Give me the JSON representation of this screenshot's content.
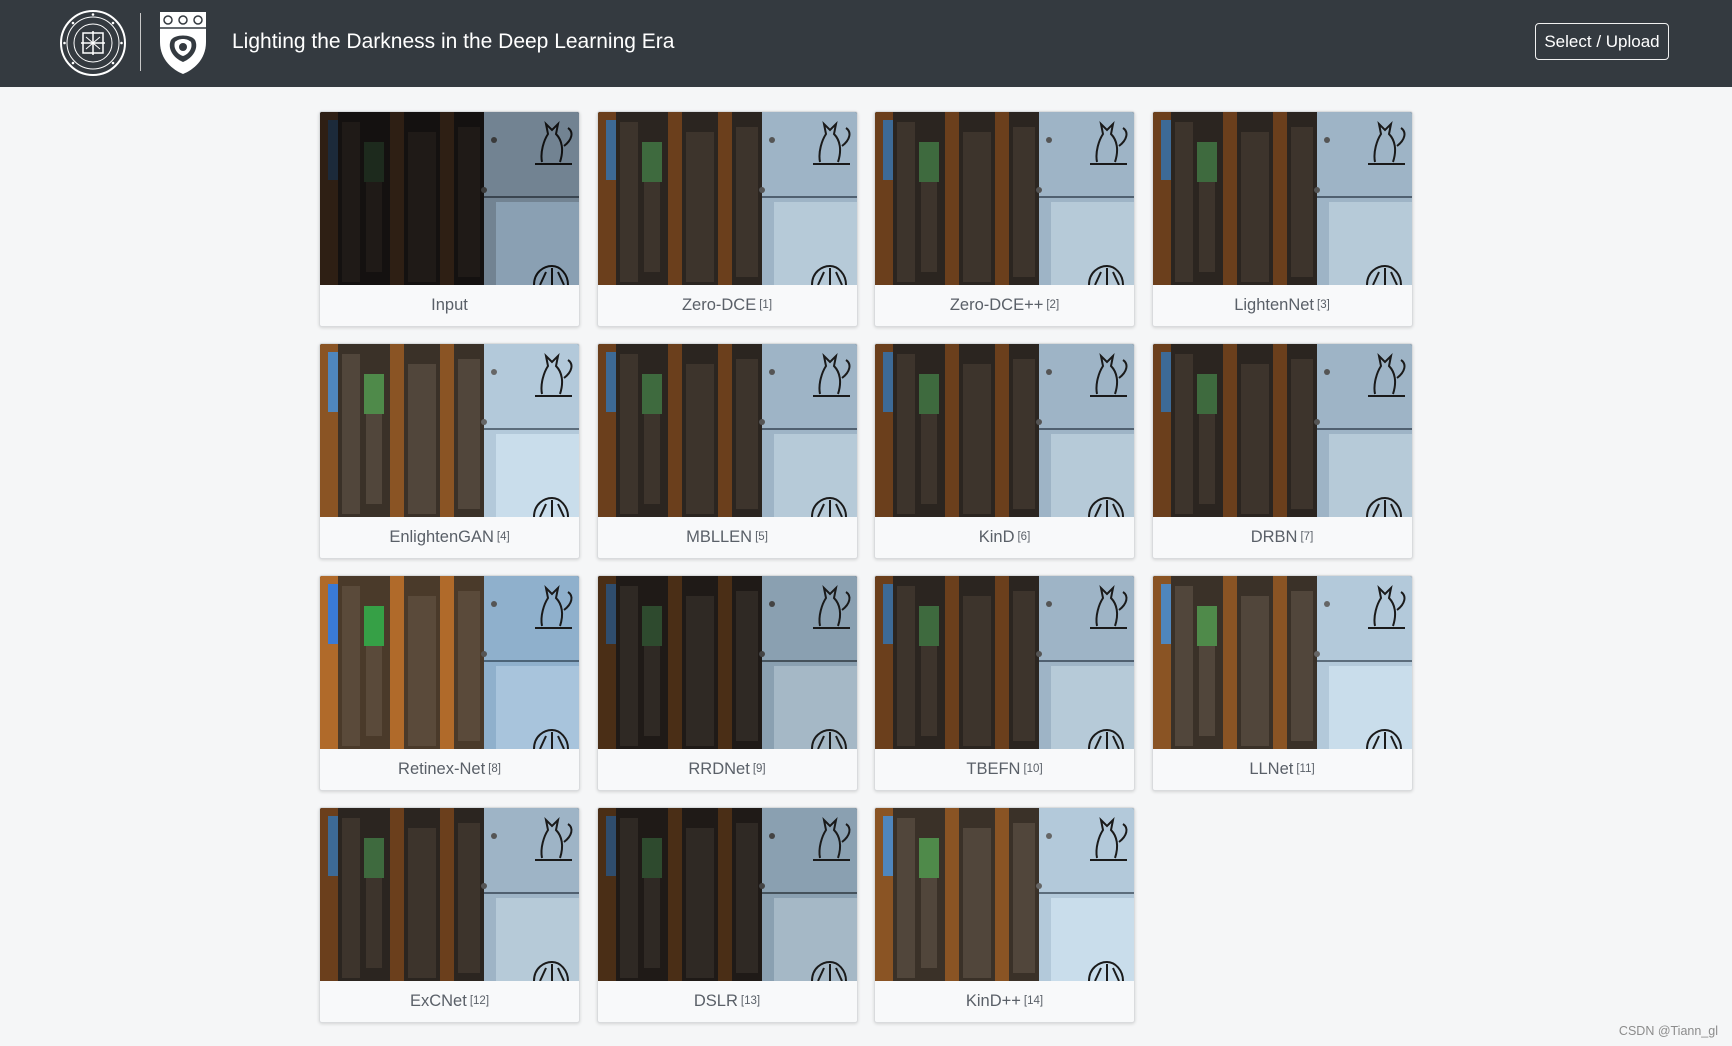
{
  "header": {
    "title": "Lighting the Darkness in the Deep Learning Era",
    "upload_label": "Select / Upload"
  },
  "gallery": [
    {
      "name": "Input",
      "ref": "",
      "tone": "dark"
    },
    {
      "name": "Zero-DCE",
      "ref": "[1]",
      "tone": "medium"
    },
    {
      "name": "Zero-DCE++",
      "ref": "[2]",
      "tone": "medium"
    },
    {
      "name": "LightenNet",
      "ref": "[3]",
      "tone": "medium"
    },
    {
      "name": "EnlightenGAN",
      "ref": "[4]",
      "tone": "bright"
    },
    {
      "name": "MBLLEN",
      "ref": "[5]",
      "tone": "medium"
    },
    {
      "name": "KinD",
      "ref": "[6]",
      "tone": "medium"
    },
    {
      "name": "DRBN",
      "ref": "[7]",
      "tone": "medium"
    },
    {
      "name": "Retinex-Net",
      "ref": "[8]",
      "tone": "vivid"
    },
    {
      "name": "RRDNet",
      "ref": "[9]",
      "tone": "dim"
    },
    {
      "name": "TBEFN",
      "ref": "[10]",
      "tone": "medium"
    },
    {
      "name": "LLNet",
      "ref": "[11]",
      "tone": "bright"
    },
    {
      "name": "ExCNet",
      "ref": "[12]",
      "tone": "medium"
    },
    {
      "name": "DSLR",
      "ref": "[13]",
      "tone": "dim"
    },
    {
      "name": "KinD++",
      "ref": "[14]",
      "tone": "bright"
    }
  ],
  "watermark": "CSDN @Tiann_gl",
  "colors": {
    "navbar": "#343a40",
    "background": "#f5f6f7",
    "caption": "#5a6068"
  },
  "icons": [
    "nankai-university-logo",
    "college-shield-logo"
  ]
}
